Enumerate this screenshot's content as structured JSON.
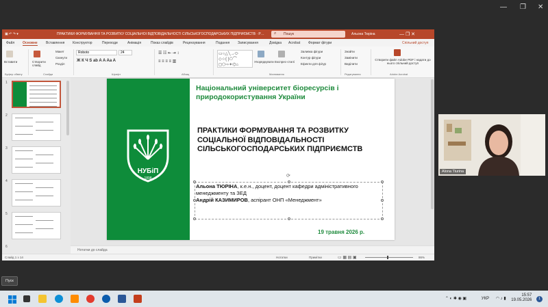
{
  "app": {
    "window_title": "ПРАКТИКИ ФОРМУВАННЯ ТА РОЗВИТКУ СОЦІАЛЬНОЇ ВІДПОВІДАЛЬНОСТІ СІЛЬСЬКОГОСПОДАРСЬКИХ ПІДПРИЄМСТВ · PowerPoint",
    "search_placeholder": "Пошук",
    "user_name": "Альона Тюріна"
  },
  "menu": {
    "items": [
      "Файл",
      "Основне",
      "Вставлення",
      "Конструктор",
      "Переходи",
      "Анімація",
      "Показ слайдів",
      "Рецензування",
      "Подання",
      "Записування",
      "Довідка",
      "Acrobat",
      "Формат фігури"
    ],
    "active_index": 1,
    "share_label": "Спільний доступ"
  },
  "ribbon": {
    "paste": "Вставити",
    "new_slide": "Створити слайд",
    "cut": "Макет",
    "copy": "Скинути",
    "sections": "Розділ",
    "font_name": "Roboto",
    "font_size": "24",
    "shapes_label": "Фігури",
    "arrange": "Упорядкувати",
    "quick_styles": "Експрес-стилі",
    "fill": "Заливка фігури",
    "outline": "Контур фігури",
    "effects": "Ефекти для фігур",
    "find": "Знайти",
    "replace": "Замінити",
    "select": "Виділити",
    "acrobat_label": "Створити файл Adobe PDF і надати до нього спільний доступ",
    "group_clipboard": "Буфер обміну",
    "group_slides": "Слайди",
    "group_font": "Шрифт",
    "group_paragraph": "Абзац",
    "group_drawing": "Малювання",
    "group_editing": "Редагування",
    "group_adobe": "Adobe Acrobat"
  },
  "thumbnails": [
    "1",
    "2",
    "3",
    "4",
    "5",
    "6"
  ],
  "slide": {
    "logo_text": "НУБіП",
    "logo_year": "1898",
    "university": "Національний університет біоресурсів і природокористування України",
    "title": "ПРАКТИКИ ФОРМУВАННЯ ТА РОЗВИТКУ СОЦІАЛЬНОЇ ВІДПОВІДАЛЬНОСТІ СІЛЬСЬКОГОСПОДАРСЬКИХ ПІДПРИЄМСТВ",
    "author1_name": "Альона ТЮРІНА",
    "author1_rest": ", к.е.н., доцент, доцент кафедри адміністративного менеджменту та ЗЕД",
    "author2_name": "Андрій КАЗИМИРОВ",
    "author2_rest": ", аспірант ОНП «Менеджмент»",
    "date": "19 травня 2026 р."
  },
  "notes_placeholder": "Нотатки до слайда",
  "status": {
    "slide_info": "Слайд 1 з 14",
    "notes_btn": "Нотатки",
    "comments_btn": "Примітки",
    "zoom": "86%"
  },
  "video": {
    "participant": "Alona Tiurina"
  },
  "start_tooltip": "Пуск",
  "taskbar": {
    "lang": "УКР",
    "time": "15:57",
    "date": "19.05.2026",
    "colors": {
      "start": "#0078d4",
      "explorer": "#f4c430",
      "edge": "#0c8fd6",
      "chrome": "#e33b2e",
      "word": "#2b5797"
    }
  }
}
